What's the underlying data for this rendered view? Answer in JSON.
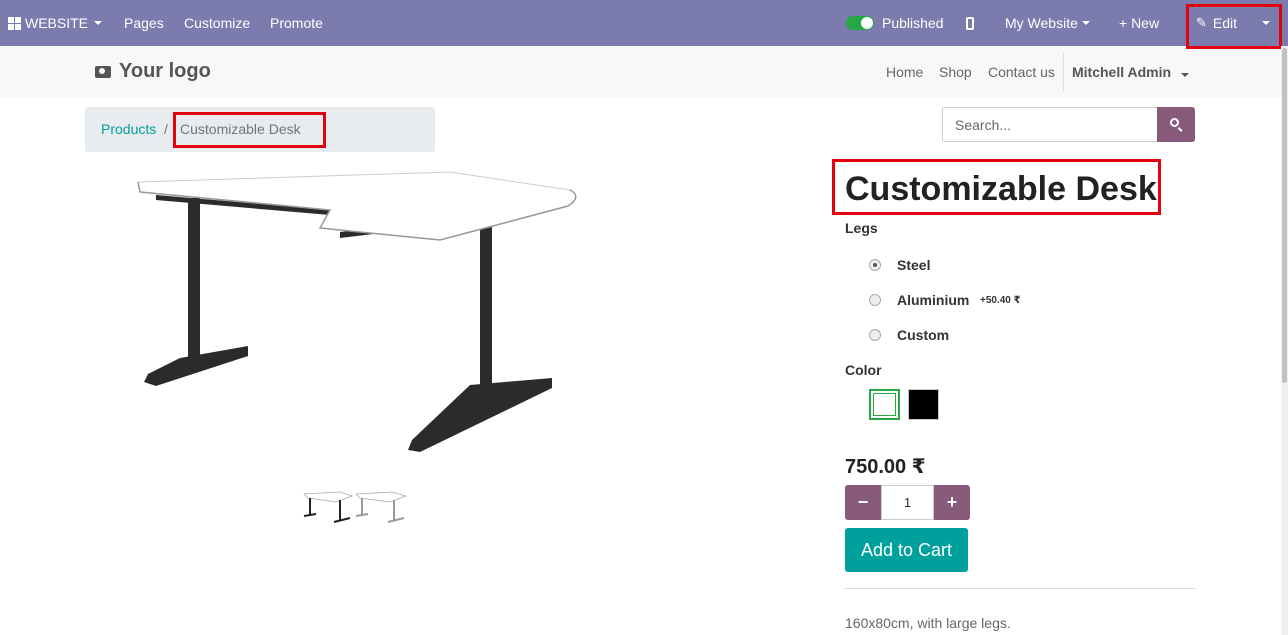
{
  "topbar": {
    "website_label": "WEBSITE",
    "pages": "Pages",
    "customize": "Customize",
    "promote": "Promote",
    "published": "Published",
    "my_website": "My Website",
    "new": "+ New",
    "edit": "Edit"
  },
  "header": {
    "logo": "Your logo",
    "nav": [
      "Home",
      "Shop",
      "Contact us"
    ],
    "user": "Mitchell Admin"
  },
  "breadcrumb": {
    "parent": "Products",
    "separator": "/",
    "current": "Customizable Desk"
  },
  "search": {
    "placeholder": "Search..."
  },
  "product": {
    "title": "Customizable Desk",
    "attr_legs": "Legs",
    "legs": [
      {
        "label": "Steel",
        "selected": true
      },
      {
        "label": "Aluminium",
        "extra": "+50.40 ₹",
        "selected": false
      },
      {
        "label": "Custom",
        "selected": false
      }
    ],
    "attr_color": "Color",
    "colors": [
      "#ffffff",
      "#000000"
    ],
    "price": "750.00 ₹",
    "quantity": "1",
    "minus": "−",
    "plus": "+",
    "add_to_cart": "Add to Cart",
    "description": "160x80cm, with large legs."
  },
  "colors": {
    "topbar": "#7c7bad",
    "primary": "#875a7b",
    "teal": "#00a09d",
    "highlight": "#e3000f"
  }
}
